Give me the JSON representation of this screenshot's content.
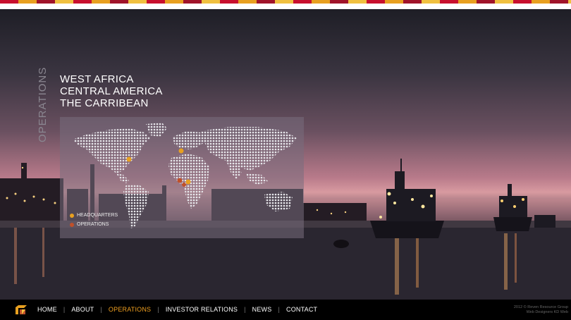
{
  "section_title": "OPERATIONS",
  "regions": [
    "WEST AFRICA",
    "CENTRAL AMERICA",
    "THE CARRIBEAN"
  ],
  "legend": [
    {
      "label": "HEADQUARTERS",
      "color": "#e8a020"
    },
    {
      "label": "OPERATIONS",
      "color": "#c0502a"
    }
  ],
  "nav": {
    "items": [
      {
        "label": "HOME",
        "active": false
      },
      {
        "label": "ABOUT",
        "active": false
      },
      {
        "label": "OPERATIONS",
        "active": true
      },
      {
        "label": "INVESTOR RELATIONS",
        "active": false
      },
      {
        "label": "NEWS",
        "active": false
      },
      {
        "label": "CONTACT",
        "active": false
      }
    ]
  },
  "copyright": {
    "line1": "2012 © Reven Resource Group",
    "line2": "Web Designers KD Web"
  },
  "colors": {
    "active": "#f0a020",
    "headquarters": "#e8a020",
    "operations": "#c0502a"
  }
}
